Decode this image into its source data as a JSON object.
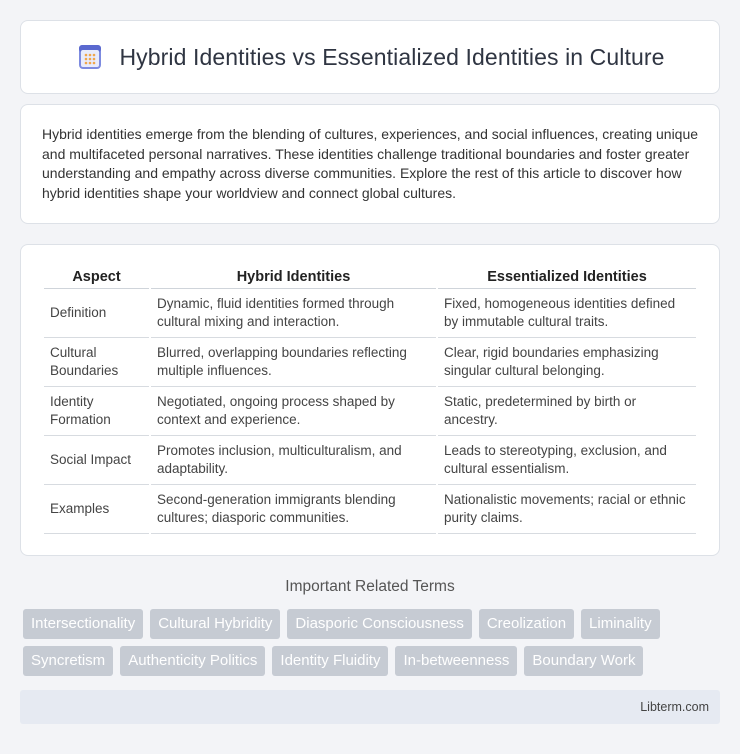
{
  "header": {
    "title": "Hybrid Identities vs Essentialized Identities in Culture",
    "logo_icon": "document-grid-icon"
  },
  "intro": {
    "text": "Hybrid identities emerge from the blending of cultures, experiences, and social influences, creating unique and multifaceted personal narratives. These identities challenge traditional boundaries and foster greater understanding and empathy across diverse communities. Explore the rest of this article to discover how hybrid identities shape your worldview and connect global cultures."
  },
  "table": {
    "headers": [
      "Aspect",
      "Hybrid Identities",
      "Essentialized Identities"
    ],
    "rows": [
      [
        "Definition",
        "Dynamic, fluid identities formed through cultural mixing and interaction.",
        "Fixed, homogeneous identities defined by immutable cultural traits."
      ],
      [
        "Cultural Boundaries",
        "Blurred, overlapping boundaries reflecting multiple influences.",
        "Clear, rigid boundaries emphasizing singular cultural belonging."
      ],
      [
        "Identity Formation",
        "Negotiated, ongoing process shaped by context and experience.",
        "Static, predetermined by birth or ancestry."
      ],
      [
        "Social Impact",
        "Promotes inclusion, multiculturalism, and adaptability.",
        "Leads to stereotyping, exclusion, and cultural essentialism."
      ],
      [
        "Examples",
        "Second-generation immigrants blending cultures; diasporic communities.",
        "Nationalistic movements; racial or ethnic purity claims."
      ]
    ]
  },
  "related": {
    "title": "Important Related Terms",
    "tags": [
      "Intersectionality",
      "Cultural Hybridity",
      "Diasporic Consciousness",
      "Creolization",
      "Liminality",
      "Syncretism",
      "Authenticity Politics",
      "Identity Fluidity",
      "In-betweenness",
      "Boundary Work"
    ]
  },
  "footer": {
    "site": "Libterm.com"
  },
  "colors": {
    "tag_bg": "#c6cbd3",
    "footer_bg": "#e6eaf2",
    "logo_accent": "#6c7bd8"
  }
}
